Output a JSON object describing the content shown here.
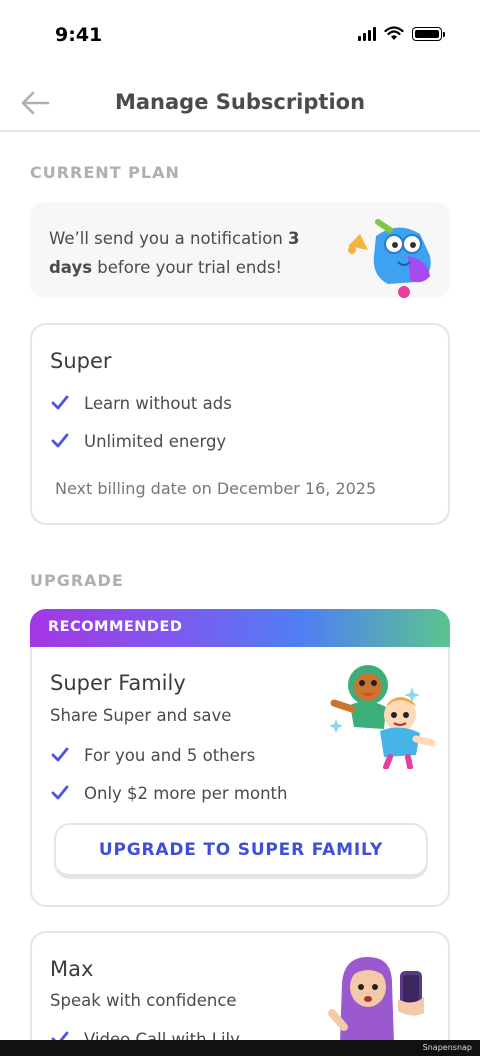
{
  "status_bar": {
    "time": "9:41"
  },
  "header": {
    "title": "Manage Subscription"
  },
  "current_plan": {
    "section_label": "CURRENT PLAN",
    "notice": {
      "text_before": "We’ll send you a notification ",
      "bold_days": "3",
      "bold_word": "days",
      "text_after": " before your trial ends!"
    },
    "plan": {
      "name": "Super",
      "features": [
        "Learn without ads",
        "Unlimited energy"
      ],
      "billing": "Next billing date on December 16, 2025"
    }
  },
  "upgrade": {
    "section_label": "UPGRADE",
    "recommended_label": "RECOMMENDED",
    "family": {
      "name": "Super Family",
      "subtitle": "Share Super and save",
      "features": [
        "For you and 5 others",
        "Only $2 more per month"
      ],
      "button_label": "UPGRADE TO SUPER FAMILY"
    },
    "max": {
      "name": "Max",
      "subtitle": "Speak with confidence",
      "features": [
        "Video Call with Lily"
      ]
    }
  },
  "watermark": "Snapensnap",
  "colors": {
    "accent_blue": "#3f4fd8",
    "check_blue": "#4b56e0",
    "label_gray": "#afafaf",
    "border_gray": "#e5e5e5",
    "notice_bg": "#f7f7f7"
  }
}
